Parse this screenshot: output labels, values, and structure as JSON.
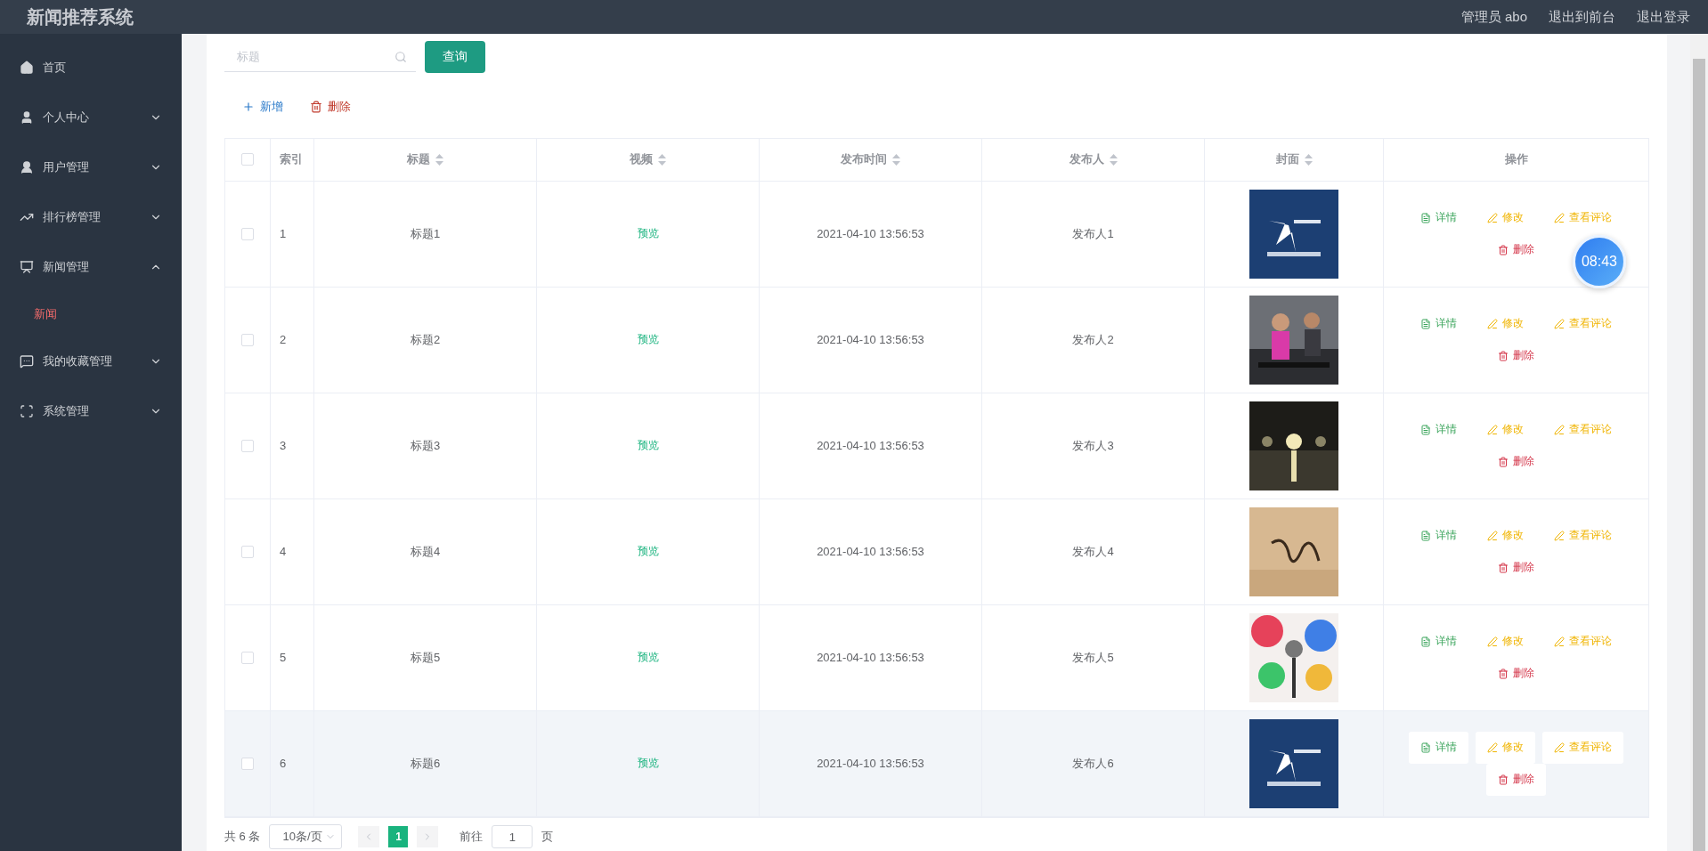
{
  "header": {
    "title": "新闻推荐系统",
    "links": [
      "管理员 abo",
      "退出到前台",
      "退出登录"
    ]
  },
  "sidebar": {
    "items": [
      {
        "label": "首页"
      },
      {
        "label": "个人中心",
        "expanded": false
      },
      {
        "label": "用户管理",
        "expanded": false
      },
      {
        "label": "排行榜管理",
        "expanded": false
      },
      {
        "label": "新闻管理",
        "expanded": true,
        "children": [
          {
            "label": "新闻",
            "selected": true
          }
        ]
      },
      {
        "label": "我的收藏管理",
        "expanded": false
      },
      {
        "label": "系统管理",
        "expanded": false
      }
    ]
  },
  "search": {
    "placeholder": "标题",
    "button": "查询"
  },
  "toolbar": [
    {
      "kind": "add",
      "label": "新增"
    },
    {
      "kind": "delete",
      "label": "删除"
    }
  ],
  "table": {
    "select_all": {
      "checked": false
    },
    "columns": [
      {
        "label": "索引",
        "sortable": false
      },
      {
        "label": "标题",
        "sortable": true
      },
      {
        "label": "视频",
        "sortable": true
      },
      {
        "label": "发布时间",
        "sortable": true
      },
      {
        "label": "发布人",
        "sortable": true
      },
      {
        "label": "封面",
        "sortable": true
      },
      {
        "label": "操作",
        "sortable": false
      }
    ],
    "rows": [
      {
        "checked": false,
        "hovered": false,
        "index": "1",
        "title": "标题1",
        "video": "预览",
        "time": "2021-04-10 13:56:53",
        "publisher": "发布人1",
        "actions": [
          {
            "kind": "detail",
            "label": "详情"
          },
          {
            "kind": "edit",
            "label": "修改"
          },
          {
            "kind": "comments",
            "label": "查看评论"
          },
          {
            "kind": "delete",
            "label": "删除"
          }
        ]
      },
      {
        "checked": false,
        "hovered": false,
        "index": "2",
        "title": "标题2",
        "video": "预览",
        "time": "2021-04-10 13:56:53",
        "publisher": "发布人2",
        "actions": [
          {
            "kind": "detail",
            "label": "详情"
          },
          {
            "kind": "edit",
            "label": "修改"
          },
          {
            "kind": "comments",
            "label": "查看评论"
          },
          {
            "kind": "delete",
            "label": "删除"
          }
        ]
      },
      {
        "checked": false,
        "hovered": false,
        "index": "3",
        "title": "标题3",
        "video": "预览",
        "time": "2021-04-10 13:56:53",
        "publisher": "发布人3",
        "actions": [
          {
            "kind": "detail",
            "label": "详情"
          },
          {
            "kind": "edit",
            "label": "修改"
          },
          {
            "kind": "comments",
            "label": "查看评论"
          },
          {
            "kind": "delete",
            "label": "删除"
          }
        ]
      },
      {
        "checked": false,
        "hovered": false,
        "index": "4",
        "title": "标题4",
        "video": "预览",
        "time": "2021-04-10 13:56:53",
        "publisher": "发布人4",
        "actions": [
          {
            "kind": "detail",
            "label": "详情"
          },
          {
            "kind": "edit",
            "label": "修改"
          },
          {
            "kind": "comments",
            "label": "查看评论"
          },
          {
            "kind": "delete",
            "label": "删除"
          }
        ]
      },
      {
        "checked": false,
        "hovered": false,
        "index": "5",
        "title": "标题5",
        "video": "预览",
        "time": "2021-04-10 13:56:53",
        "publisher": "发布人5",
        "actions": [
          {
            "kind": "detail",
            "label": "详情"
          },
          {
            "kind": "edit",
            "label": "修改"
          },
          {
            "kind": "comments",
            "label": "查看评论"
          },
          {
            "kind": "delete",
            "label": "删除"
          }
        ]
      },
      {
        "checked": false,
        "hovered": true,
        "index": "6",
        "title": "标题6",
        "video": "预览",
        "time": "2021-04-10 13:56:53",
        "publisher": "发布人6",
        "actions": [
          {
            "kind": "detail",
            "label": "详情"
          },
          {
            "kind": "edit",
            "label": "修改"
          },
          {
            "kind": "comments",
            "label": "查看评论"
          },
          {
            "kind": "delete",
            "label": "删除"
          }
        ]
      }
    ]
  },
  "pagination": {
    "total": "共 6 条",
    "page_size": "10条/页",
    "pages": [
      {
        "label": "1",
        "selected": true
      }
    ],
    "goto_label": "前往",
    "goto_value": "1",
    "goto_suffix": "页"
  },
  "clock": "08:43"
}
